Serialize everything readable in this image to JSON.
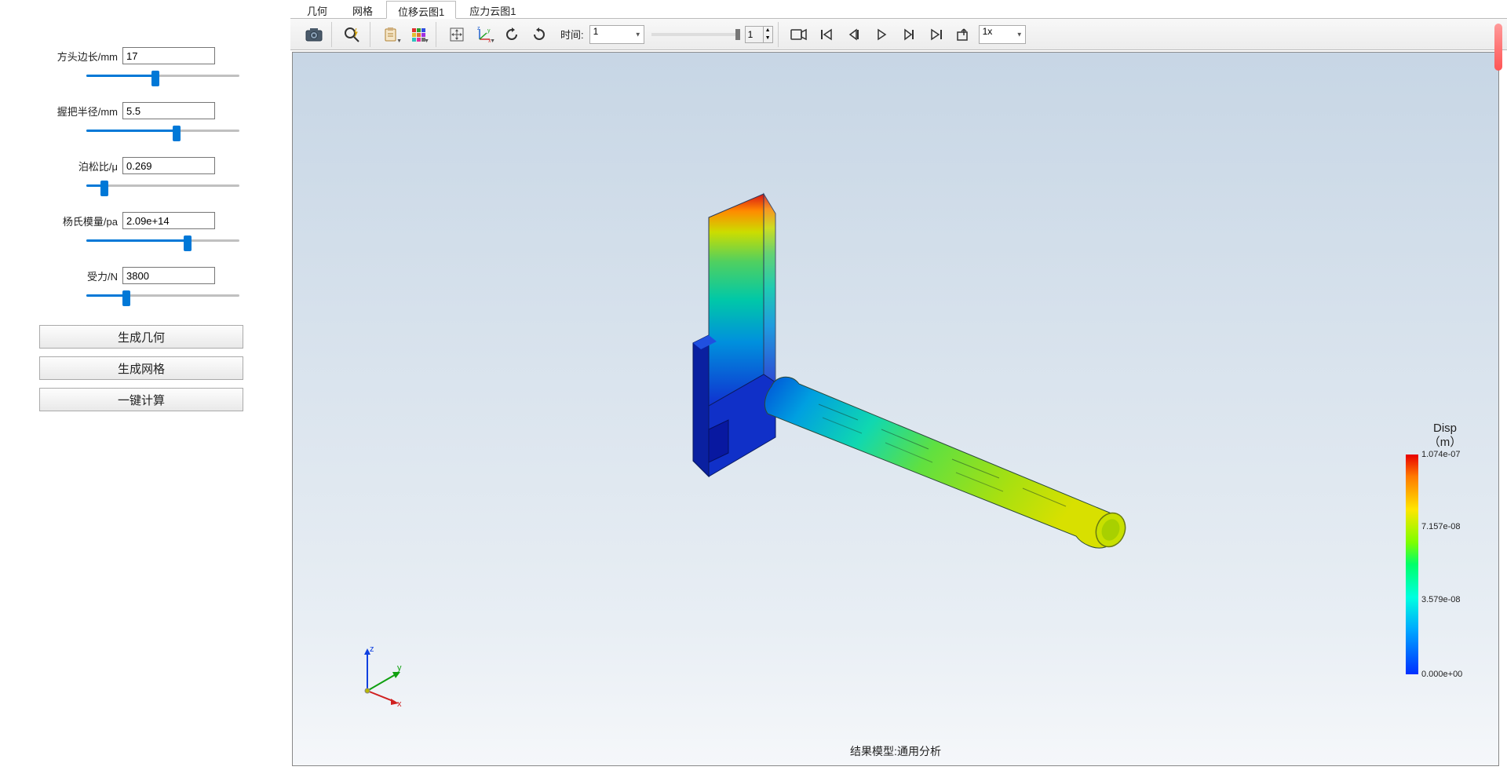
{
  "sidebar": {
    "params": [
      {
        "label": "方头边长/mm",
        "value": "17",
        "fill": 45
      },
      {
        "label": "握把半径/mm",
        "value": "5.5",
        "fill": 59
      },
      {
        "label": "泊松比/μ",
        "value": "0.269",
        "fill": 12
      },
      {
        "label": "杨氏模量/pa",
        "value": "2.09e+14",
        "fill": 66
      },
      {
        "label": "受力/N",
        "value": "3800",
        "fill": 26
      }
    ],
    "buttons": [
      "生成几何",
      "生成网格",
      "一键计算"
    ]
  },
  "tabs": {
    "items": [
      "几何",
      "网格",
      "位移云图1",
      "应力云图1"
    ],
    "active": 2
  },
  "toolbar": {
    "time_label": "时间:",
    "time_value": "1",
    "frame_value": "1",
    "speed_value": "1x"
  },
  "viewport": {
    "footer": "结果模型:通用分析",
    "axes": {
      "x": "x",
      "y": "y",
      "z": "z"
    }
  },
  "legend": {
    "title_line1": "Disp",
    "title_line2": "（m）",
    "ticks": [
      {
        "pos": 0,
        "label": "1.074e-07"
      },
      {
        "pos": 33,
        "label": "7.157e-08"
      },
      {
        "pos": 66,
        "label": "3.579e-08"
      },
      {
        "pos": 100,
        "label": "0.000e+00"
      }
    ]
  }
}
